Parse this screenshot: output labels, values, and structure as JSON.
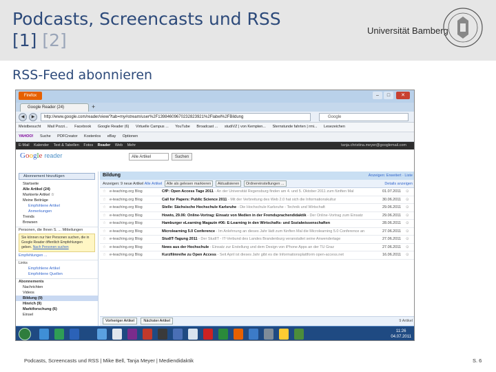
{
  "slide": {
    "title_line1": "Podcasts, Screencasts und RSS",
    "ref1": "[1]",
    "ref2": "[2]",
    "university": "Universität Bamberg",
    "section_heading": "RSS-Feed abonnieren",
    "footer": "Podcasts, Screencasts und RSS  |  Mike Bell, Tanja Meyer  |  Mediendidaktik",
    "page_number": "S. 6"
  },
  "browser": {
    "app_button": "Firefox",
    "tab_label": "Google Reader (24)",
    "tab_new": "+",
    "url": "http://www.google.com/reader/view/?tab=my#stream/user%2F13984609670232823921%2Flabel%2FBildung",
    "search_placeholder": "Google",
    "bookmarks": [
      "Meistbesucht",
      "Mail Pozzi...",
      "Facebook",
      "Google Reader (6)",
      "Virtuelle Campus ...",
      "YouTube",
      "Broadcast ...",
      "studiVZ | von Kempten...",
      "Sternstunde fahrten | rmi...",
      "Lesezeichen"
    ],
    "toolbar2": [
      "YAHOO!",
      "Suche",
      "PDFCreator",
      "Kostenlos",
      "eBay",
      "Optionen"
    ],
    "gbar_links": [
      "E-Mail",
      "Kalender",
      "Text & Tabellen",
      "Fotos",
      "Reader",
      "Web",
      "Mehr"
    ],
    "account": "tanja.christina.meyer@googlemail.com"
  },
  "reader": {
    "logo_letters": [
      "G",
      "o",
      "o",
      "g",
      "l",
      "e"
    ],
    "logo_suffix": "reader",
    "scope_select": "Alle Artikel",
    "search_button": "Suchen",
    "add_button": "Abonnement hinzufügen",
    "nav_items": [
      {
        "label": "Startseite",
        "bold": false
      },
      {
        "label": "Alle Artikel (24)",
        "bold": true
      },
      {
        "label": "Markierte Artikel ☆",
        "bold": false
      },
      {
        "label": "Meine Beiträge",
        "bold": false
      }
    ],
    "nav_sub": [
      "Empfohlene Artikel",
      "Anmerkungen"
    ],
    "nav_items2": [
      "Trends",
      "Browsen"
    ],
    "people_section": "Personen, die Ihnen S. ... Mitteilungen",
    "tip_text": "Sie können nur hier Personen suchen, die in Google Reader öffentlich Empfehlungen geben.",
    "tip_link": "Nach Personen suchen",
    "explore": "Empfehlungen ...",
    "links_section": "Links",
    "links_items": [
      "Empfohlene Artikel",
      "Empfohlene Quellen"
    ],
    "subs_section": "Abonnements",
    "subs": [
      "Nachrichten",
      "Videos",
      "Bildung (9)",
      "Hinrich (9)",
      "Marktforschung (6)",
      "Einsel"
    ],
    "folder_title": "Bildung",
    "folder_links": "Anzeigen: Erweitert · Liste",
    "filter_prefix": "Anzeigen: 9 neue Artikel",
    "filter_all": "Alle Artikel",
    "filter_buttons": [
      "Alle als gelesen markieren",
      "Aktualisieren",
      "Ordnereinstellungen ..."
    ],
    "filter_details": "Details anzeigen",
    "articles": [
      {
        "source": "e-teaching.org Blog",
        "title": "CfP: Open Access Tage 2011",
        "snippet": " - An der Universität Regensburg finden am 4. und 5. Oktober 2011 zum fünften Mal",
        "date": "01.07.2011"
      },
      {
        "source": "e-teaching.org Blog",
        "title": "Call for Papers: Public Science 2011",
        "snippet": " - Mit der Verbreitung des Web 2.0 hat sich die Informationskultur",
        "date": "30.06.2011"
      },
      {
        "source": "e-teaching.org Blog",
        "title": "Stelle: Sächsische Hochschule Karlsruhe",
        "snippet": " - Die Hochschule Karlsruhe - Technik und Wirtschaft",
        "date": "29.06.2011"
      },
      {
        "source": "e-teaching.org Blog",
        "title": "Howto, 29.06: Online-Vortrag: Einsatz von Medien in der Fremdsprachendidaktik",
        "snippet": " - Der Online-Vortrag zum Einsatz",
        "date": "29.06.2011"
      },
      {
        "source": "e-teaching.org Blog",
        "title": "Hamburger eLearning Magazin #06: E-Learning in den Wirtschafts- und Sozialwissenschaften",
        "snippet": "",
        "date": "28.06.2011"
      },
      {
        "source": "e-teaching.org Blog",
        "title": "Microlearning 5.0 Conference",
        "snippet": " - Im Anlehnung an dieses Jahr lädt zum fünften Mal die Microlearning 5.0 Conference an",
        "date": "27.06.2011"
      },
      {
        "source": "e-teaching.org Blog",
        "title": "StudIT-Tagung 2011",
        "snippet": " - Der StudIT - IT-Verbund des Landes Brandenburg veranstaltet seine Anwendertage",
        "date": "27.06.2011"
      },
      {
        "source": "e-teaching.org Blog",
        "title": "News aus der Hochschule",
        "snippet": " - Einsatz zur Erstellung und dem Design von iPhone Apps an der TU Graz",
        "date": "27.06.2011"
      },
      {
        "source": "e-teaching.org Blog",
        "title": "Kurzfilmreihe zu Open Access",
        "snippet": " - Seit April ist dieses Jahr gibt es die Informationsplattform open-access.net",
        "date": "16.06.2011"
      }
    ],
    "foot_buttons": [
      "Vorheriger Artikel",
      "Nächster Artikel"
    ],
    "foot_count": "9 Artikel"
  },
  "taskbar": {
    "clock_time": "11:26",
    "clock_date": "04.07.2011"
  },
  "colors": {
    "title_blue": "#2d4a7a",
    "header_band": "#e6e6e6",
    "taskbar": "#1f4a82"
  }
}
